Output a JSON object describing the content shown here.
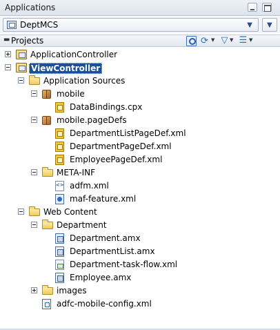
{
  "window": {
    "title": "Applications"
  },
  "app_selector": {
    "value": "DeptMCS"
  },
  "projects_panel": {
    "label": "Projects"
  },
  "tree": [
    {
      "id": "n0",
      "label": "ApplicationController",
      "depth": 0,
      "expander": "plus",
      "icon": "project",
      "icon_name": "project-icon"
    },
    {
      "id": "n1",
      "label": "ViewController",
      "depth": 0,
      "expander": "minus",
      "icon": "project",
      "icon_name": "project-icon",
      "selected": true
    },
    {
      "id": "n2",
      "label": "Application Sources",
      "depth": 1,
      "expander": "minus",
      "icon": "folder",
      "icon_name": "folder-icon"
    },
    {
      "id": "n3",
      "label": "mobile",
      "depth": 2,
      "expander": "minus",
      "icon": "pkg",
      "icon_name": "package-icon"
    },
    {
      "id": "n4",
      "label": "DataBindings.cpx",
      "depth": 3,
      "expander": "none",
      "icon": "file cpx",
      "icon_name": "cpx-file-icon"
    },
    {
      "id": "n5",
      "label": "mobile.pageDefs",
      "depth": 2,
      "expander": "minus",
      "icon": "pkg",
      "icon_name": "package-icon"
    },
    {
      "id": "n6",
      "label": "DepartmentListPageDef.xml",
      "depth": 3,
      "expander": "none",
      "icon": "file xml-y",
      "icon_name": "pagedef-file-icon"
    },
    {
      "id": "n7",
      "label": "DepartmentPageDef.xml",
      "depth": 3,
      "expander": "none",
      "icon": "file xml-y",
      "icon_name": "pagedef-file-icon"
    },
    {
      "id": "n8",
      "label": "EmployeePageDef.xml",
      "depth": 3,
      "expander": "none",
      "icon": "file xml-y",
      "icon_name": "pagedef-file-icon"
    },
    {
      "id": "n9",
      "label": "META-INF",
      "depth": 2,
      "expander": "minus",
      "icon": "folder",
      "icon_name": "folder-icon"
    },
    {
      "id": "n10",
      "label": "adfm.xml",
      "depth": 3,
      "expander": "none",
      "icon": "file xml",
      "icon_name": "xml-file-icon"
    },
    {
      "id": "n11",
      "label": "maf-feature.xml",
      "depth": 3,
      "expander": "none",
      "icon": "file maf",
      "icon_name": "maf-feature-file-icon"
    },
    {
      "id": "n12",
      "label": "Web Content",
      "depth": 1,
      "expander": "minus",
      "icon": "folder",
      "icon_name": "folder-icon"
    },
    {
      "id": "n13",
      "label": "Department",
      "depth": 2,
      "expander": "minus",
      "icon": "folder",
      "icon_name": "folder-icon"
    },
    {
      "id": "n14",
      "label": "Department.amx",
      "depth": 3,
      "expander": "none",
      "icon": "file amx",
      "icon_name": "amx-file-icon"
    },
    {
      "id": "n15",
      "label": "DepartmentList.amx",
      "depth": 3,
      "expander": "none",
      "icon": "file amx",
      "icon_name": "amx-file-icon"
    },
    {
      "id": "n16",
      "label": "Department-task-flow.xml",
      "depth": 3,
      "expander": "none",
      "icon": "file tf",
      "icon_name": "task-flow-file-icon"
    },
    {
      "id": "n17",
      "label": "Employee.amx",
      "depth": 3,
      "expander": "none",
      "icon": "file amx",
      "icon_name": "amx-file-icon"
    },
    {
      "id": "n18",
      "label": "images",
      "depth": 2,
      "expander": "plus",
      "icon": "folder",
      "icon_name": "folder-icon"
    },
    {
      "id": "n19",
      "label": "adfc-mobile-config.xml",
      "depth": 2,
      "expander": "none",
      "icon": "file cfg",
      "icon_name": "config-file-icon"
    }
  ]
}
